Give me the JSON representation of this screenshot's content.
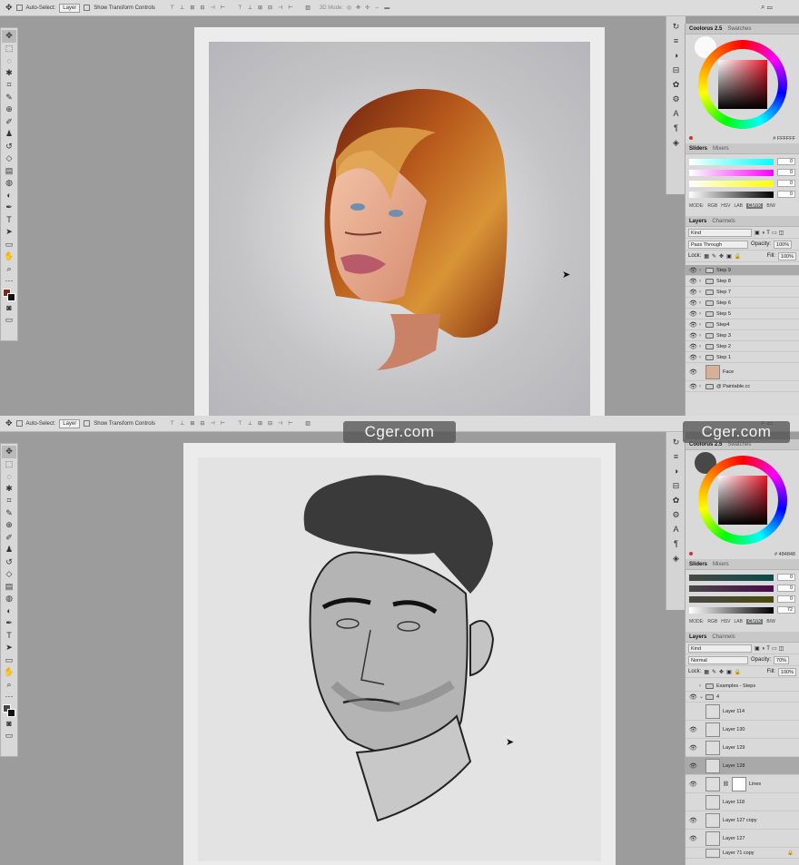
{
  "top": {
    "options_bar": {
      "auto_select_label": "Auto-Select:",
      "auto_select_value": "Layer",
      "transform_label": "Show Transform Controls",
      "mode_label": "3D Mode:"
    },
    "color_panel": {
      "tab_active": "Coolorus 2.5",
      "tab_other": "Swatches",
      "hex": "FFFFFF",
      "swatch_color": "#ffffff",
      "square_hue": "#e8182a"
    },
    "sliders_panel": {
      "tab_active": "Sliders",
      "tab_other": "Mixers",
      "values": [
        "0",
        "0",
        "0",
        "0"
      ],
      "modes": [
        "MODE:",
        "RGB",
        "HSV",
        "LAB",
        "CMYK",
        "B/W"
      ],
      "current_mode": "CMYK"
    },
    "layers_panel": {
      "tab_active": "Layers",
      "tab_other": "Channels",
      "kind": "Kind",
      "blend": "Pass Through",
      "opacity_label": "Opacity:",
      "opacity": "100%",
      "lock_label": "Lock:",
      "fill_label": "Fill:",
      "fill": "100%",
      "layers": [
        "Step 9",
        "Step 8",
        "Step 7",
        "Step 6",
        "Step 5",
        "Step4",
        "Step 3",
        "Step 2",
        "Step 1",
        "Face",
        "@ Paintable.cc"
      ]
    }
  },
  "bottom": {
    "options_bar": {
      "auto_select_label": "Auto-Select:",
      "auto_select_value": "Layer",
      "transform_label": "Show Transform Controls"
    },
    "color_panel": {
      "tab_active": "Coolorus 2.5",
      "tab_other": "Swatches",
      "hex": "484848",
      "swatch_color": "#484848",
      "square_hue": "#e8182a"
    },
    "sliders_panel": {
      "tab_active": "Sliders",
      "tab_other": "Mixers",
      "values": [
        "0",
        "0",
        "0",
        "72"
      ],
      "modes": [
        "MODE:",
        "RGB",
        "HSV",
        "LAB",
        "CMYK",
        "B/W"
      ],
      "current_mode": "CMYK"
    },
    "layers_panel": {
      "tab_active": "Layers",
      "tab_other": "Channels",
      "kind": "Kind",
      "blend": "Normal",
      "opacity_label": "Opacity:",
      "opacity": "70%",
      "lock_label": "Lock:",
      "fill_label": "Fill:",
      "fill": "100%",
      "layers": [
        "Examples - Steps",
        "4",
        "Layer 114",
        "Layer 130",
        "Layer 129",
        "Layer 128",
        "Lines",
        "Layer 118",
        "Layer 127 copy",
        "Layer 127",
        "Layer 71 copy"
      ]
    }
  },
  "watermark": "Cger.com",
  "colors": {
    "app_bg": "#9c9c9c",
    "panel_bg": "#d9d9d9",
    "selected_row": "#a9a9a9"
  }
}
